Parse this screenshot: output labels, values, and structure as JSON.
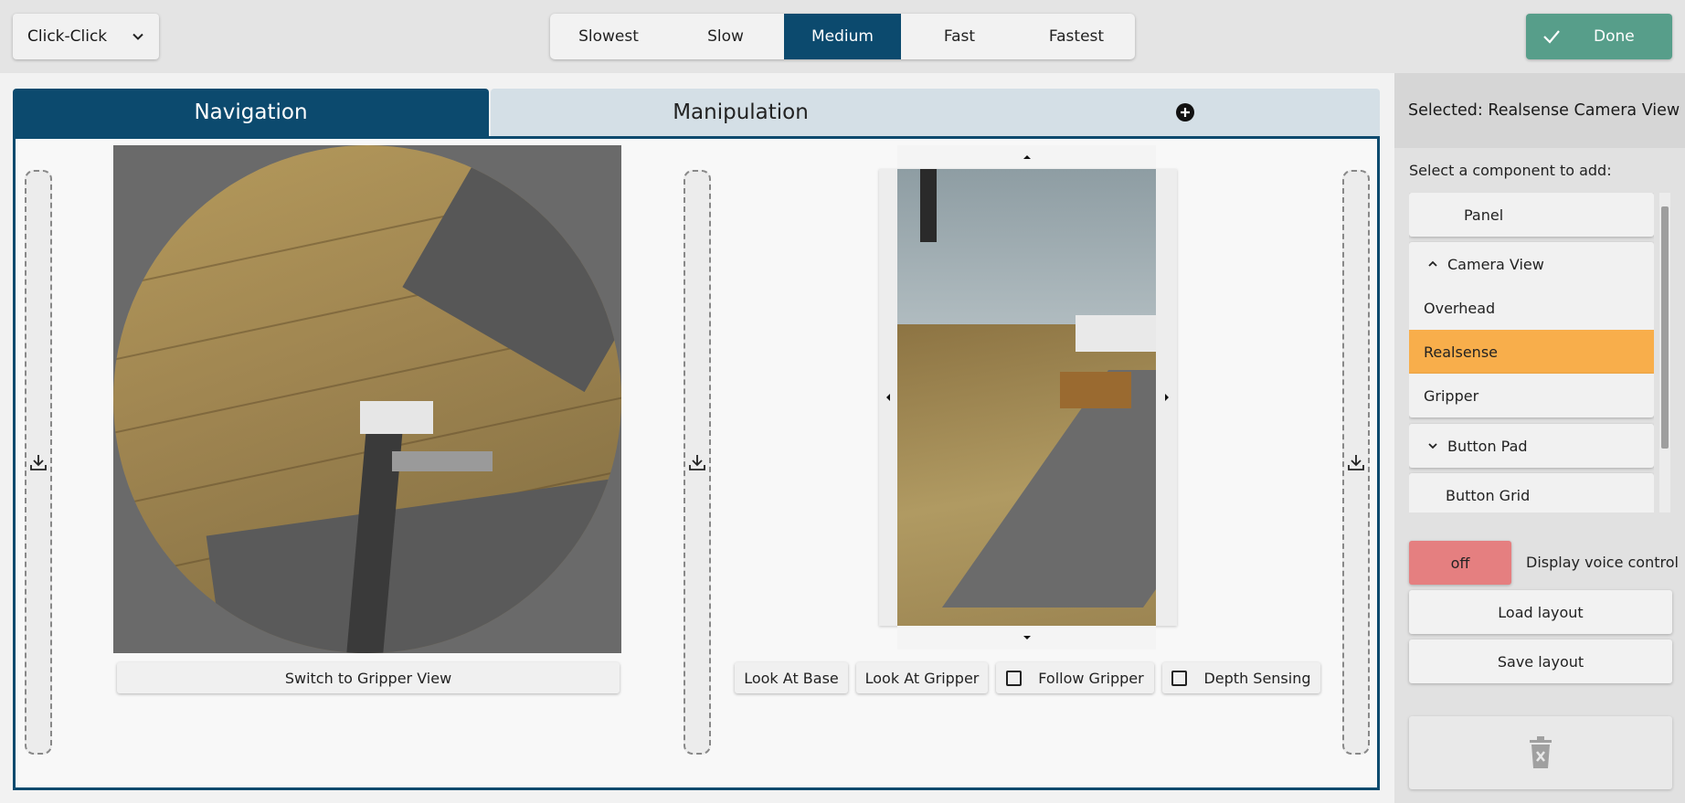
{
  "toolbar": {
    "mode_select": "Click-Click",
    "speeds": [
      "Slowest",
      "Slow",
      "Medium",
      "Fast",
      "Fastest"
    ],
    "active_speed": "Medium",
    "done_label": "Done"
  },
  "tabs": {
    "navigation": "Navigation",
    "manipulation": "Manipulation"
  },
  "navigation_panel": {
    "switch_view_button": "Switch to Gripper View"
  },
  "realsense_panel": {
    "look_at_base": "Look At Base",
    "look_at_gripper": "Look At Gripper",
    "follow_gripper": "Follow Gripper",
    "depth_sensing": "Depth Sensing"
  },
  "sidebar": {
    "title": "Selected: Realsense Camera View",
    "subtitle": "Select a component to add:",
    "components": {
      "panel": "Panel",
      "camera_view": "Camera View",
      "overhead": "Overhead",
      "realsense": "Realsense",
      "gripper": "Gripper",
      "button_pad": "Button Pad",
      "button_grid": "Button Grid"
    },
    "selected_component": "Realsense",
    "voice_toggle": "off",
    "voice_label": "Display voice control",
    "load_layout": "Load layout",
    "save_layout": "Save layout"
  },
  "colors": {
    "primary": "#0c4a6e",
    "done": "#579e8a",
    "selected_item": "#f8ae4b",
    "toggle_off": "#e57f80"
  }
}
